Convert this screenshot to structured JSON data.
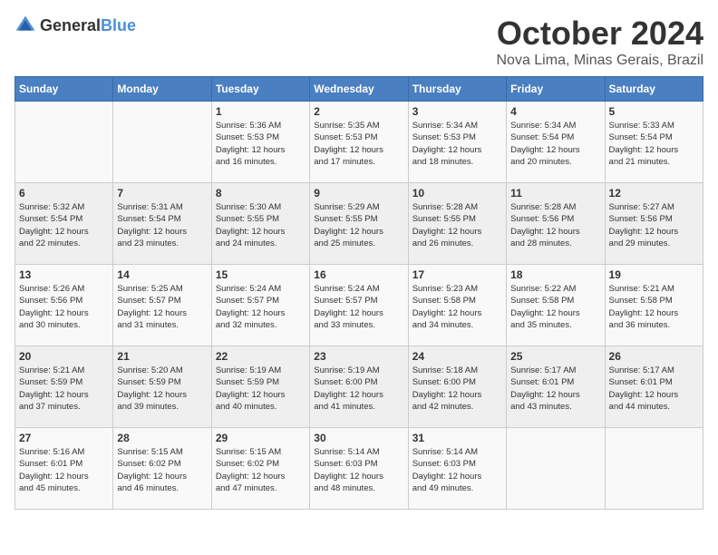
{
  "header": {
    "logo_general": "General",
    "logo_blue": "Blue",
    "month": "October 2024",
    "location": "Nova Lima, Minas Gerais, Brazil"
  },
  "days_of_week": [
    "Sunday",
    "Monday",
    "Tuesday",
    "Wednesday",
    "Thursday",
    "Friday",
    "Saturday"
  ],
  "weeks": [
    [
      {
        "day": "",
        "info": ""
      },
      {
        "day": "",
        "info": ""
      },
      {
        "day": "1",
        "info": "Sunrise: 5:36 AM\nSunset: 5:53 PM\nDaylight: 12 hours\nand 16 minutes."
      },
      {
        "day": "2",
        "info": "Sunrise: 5:35 AM\nSunset: 5:53 PM\nDaylight: 12 hours\nand 17 minutes."
      },
      {
        "day": "3",
        "info": "Sunrise: 5:34 AM\nSunset: 5:53 PM\nDaylight: 12 hours\nand 18 minutes."
      },
      {
        "day": "4",
        "info": "Sunrise: 5:34 AM\nSunset: 5:54 PM\nDaylight: 12 hours\nand 20 minutes."
      },
      {
        "day": "5",
        "info": "Sunrise: 5:33 AM\nSunset: 5:54 PM\nDaylight: 12 hours\nand 21 minutes."
      }
    ],
    [
      {
        "day": "6",
        "info": "Sunrise: 5:32 AM\nSunset: 5:54 PM\nDaylight: 12 hours\nand 22 minutes."
      },
      {
        "day": "7",
        "info": "Sunrise: 5:31 AM\nSunset: 5:54 PM\nDaylight: 12 hours\nand 23 minutes."
      },
      {
        "day": "8",
        "info": "Sunrise: 5:30 AM\nSunset: 5:55 PM\nDaylight: 12 hours\nand 24 minutes."
      },
      {
        "day": "9",
        "info": "Sunrise: 5:29 AM\nSunset: 5:55 PM\nDaylight: 12 hours\nand 25 minutes."
      },
      {
        "day": "10",
        "info": "Sunrise: 5:28 AM\nSunset: 5:55 PM\nDaylight: 12 hours\nand 26 minutes."
      },
      {
        "day": "11",
        "info": "Sunrise: 5:28 AM\nSunset: 5:56 PM\nDaylight: 12 hours\nand 28 minutes."
      },
      {
        "day": "12",
        "info": "Sunrise: 5:27 AM\nSunset: 5:56 PM\nDaylight: 12 hours\nand 29 minutes."
      }
    ],
    [
      {
        "day": "13",
        "info": "Sunrise: 5:26 AM\nSunset: 5:56 PM\nDaylight: 12 hours\nand 30 minutes."
      },
      {
        "day": "14",
        "info": "Sunrise: 5:25 AM\nSunset: 5:57 PM\nDaylight: 12 hours\nand 31 minutes."
      },
      {
        "day": "15",
        "info": "Sunrise: 5:24 AM\nSunset: 5:57 PM\nDaylight: 12 hours\nand 32 minutes."
      },
      {
        "day": "16",
        "info": "Sunrise: 5:24 AM\nSunset: 5:57 PM\nDaylight: 12 hours\nand 33 minutes."
      },
      {
        "day": "17",
        "info": "Sunrise: 5:23 AM\nSunset: 5:58 PM\nDaylight: 12 hours\nand 34 minutes."
      },
      {
        "day": "18",
        "info": "Sunrise: 5:22 AM\nSunset: 5:58 PM\nDaylight: 12 hours\nand 35 minutes."
      },
      {
        "day": "19",
        "info": "Sunrise: 5:21 AM\nSunset: 5:58 PM\nDaylight: 12 hours\nand 36 minutes."
      }
    ],
    [
      {
        "day": "20",
        "info": "Sunrise: 5:21 AM\nSunset: 5:59 PM\nDaylight: 12 hours\nand 37 minutes."
      },
      {
        "day": "21",
        "info": "Sunrise: 5:20 AM\nSunset: 5:59 PM\nDaylight: 12 hours\nand 39 minutes."
      },
      {
        "day": "22",
        "info": "Sunrise: 5:19 AM\nSunset: 5:59 PM\nDaylight: 12 hours\nand 40 minutes."
      },
      {
        "day": "23",
        "info": "Sunrise: 5:19 AM\nSunset: 6:00 PM\nDaylight: 12 hours\nand 41 minutes."
      },
      {
        "day": "24",
        "info": "Sunrise: 5:18 AM\nSunset: 6:00 PM\nDaylight: 12 hours\nand 42 minutes."
      },
      {
        "day": "25",
        "info": "Sunrise: 5:17 AM\nSunset: 6:01 PM\nDaylight: 12 hours\nand 43 minutes."
      },
      {
        "day": "26",
        "info": "Sunrise: 5:17 AM\nSunset: 6:01 PM\nDaylight: 12 hours\nand 44 minutes."
      }
    ],
    [
      {
        "day": "27",
        "info": "Sunrise: 5:16 AM\nSunset: 6:01 PM\nDaylight: 12 hours\nand 45 minutes."
      },
      {
        "day": "28",
        "info": "Sunrise: 5:15 AM\nSunset: 6:02 PM\nDaylight: 12 hours\nand 46 minutes."
      },
      {
        "day": "29",
        "info": "Sunrise: 5:15 AM\nSunset: 6:02 PM\nDaylight: 12 hours\nand 47 minutes."
      },
      {
        "day": "30",
        "info": "Sunrise: 5:14 AM\nSunset: 6:03 PM\nDaylight: 12 hours\nand 48 minutes."
      },
      {
        "day": "31",
        "info": "Sunrise: 5:14 AM\nSunset: 6:03 PM\nDaylight: 12 hours\nand 49 minutes."
      },
      {
        "day": "",
        "info": ""
      },
      {
        "day": "",
        "info": ""
      }
    ]
  ]
}
